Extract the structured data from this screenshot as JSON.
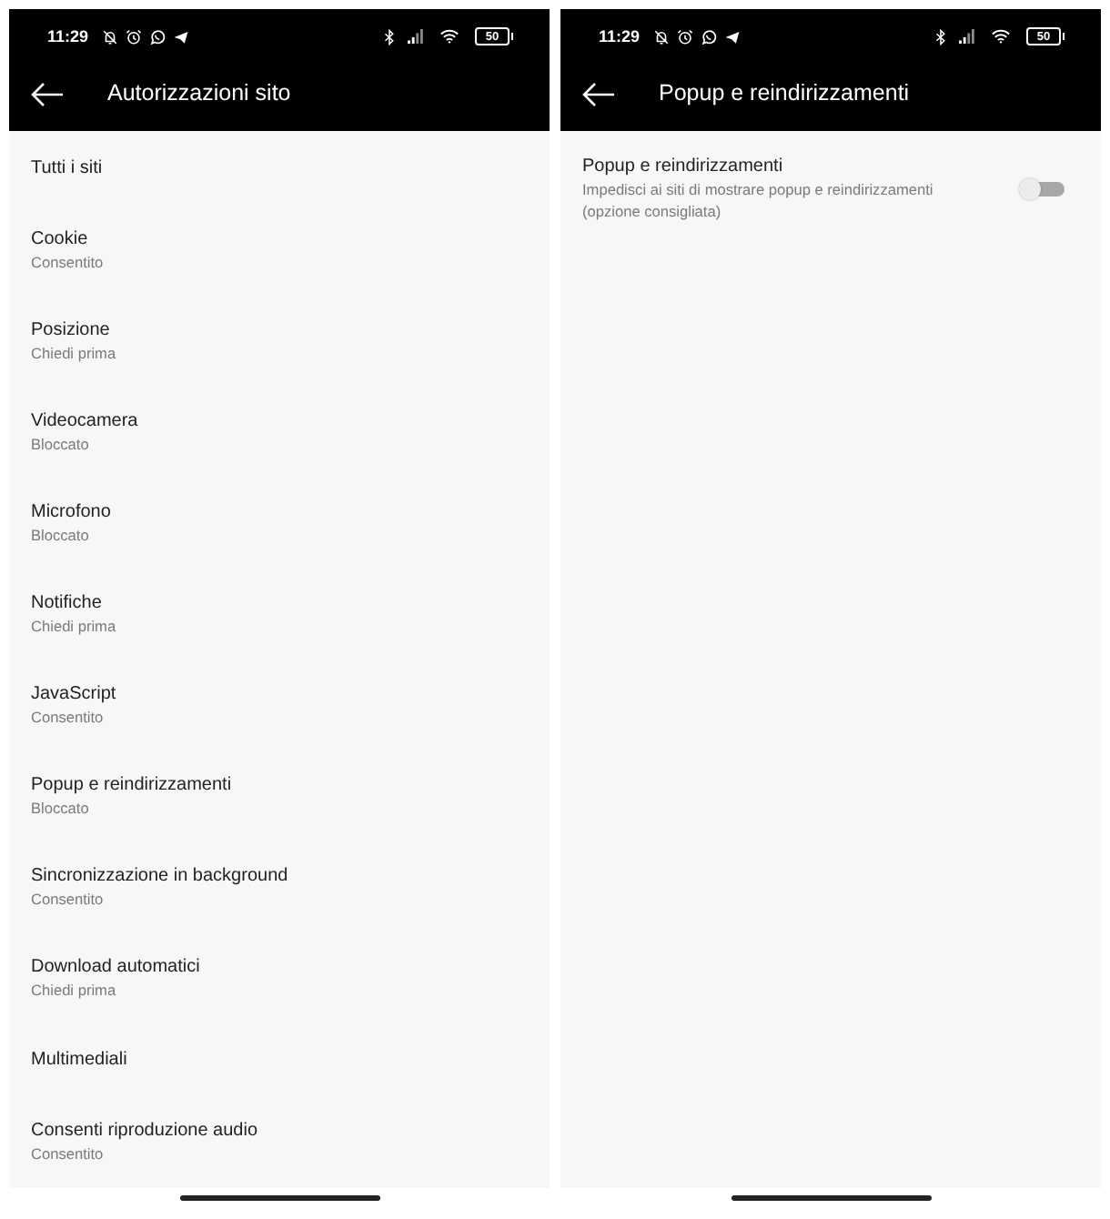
{
  "screens": [
    {
      "kind": "list",
      "status_bar": {
        "time": "11:29",
        "battery": "50"
      },
      "app_bar": {
        "title": "Autorizzazioni sito"
      },
      "items": [
        {
          "title": "Tutti i siti"
        },
        {
          "title": "Cookie",
          "subtitle": "Consentito"
        },
        {
          "title": "Posizione",
          "subtitle": "Chiedi prima"
        },
        {
          "title": "Videocamera",
          "subtitle": "Bloccato"
        },
        {
          "title": "Microfono",
          "subtitle": "Bloccato"
        },
        {
          "title": "Notifiche",
          "subtitle": "Chiedi prima"
        },
        {
          "title": "JavaScript",
          "subtitle": "Consentito"
        },
        {
          "title": "Popup e reindirizzamenti",
          "subtitle": "Bloccato"
        },
        {
          "title": "Sincronizzazione in background",
          "subtitle": "Consentito"
        },
        {
          "title": "Download automatici",
          "subtitle": "Chiedi prima"
        },
        {
          "title": "Multimediali"
        },
        {
          "title": "Consenti riproduzione audio",
          "subtitle": "Consentito"
        }
      ]
    },
    {
      "kind": "setting",
      "status_bar": {
        "time": "11:29",
        "battery": "50"
      },
      "app_bar": {
        "title": "Popup e reindirizzamenti"
      },
      "setting": {
        "title": "Popup e reindirizzamenti",
        "description": "Impedisci ai siti di mostrare popup e reindirizzamenti (opzione consigliata)",
        "on": false
      }
    }
  ]
}
